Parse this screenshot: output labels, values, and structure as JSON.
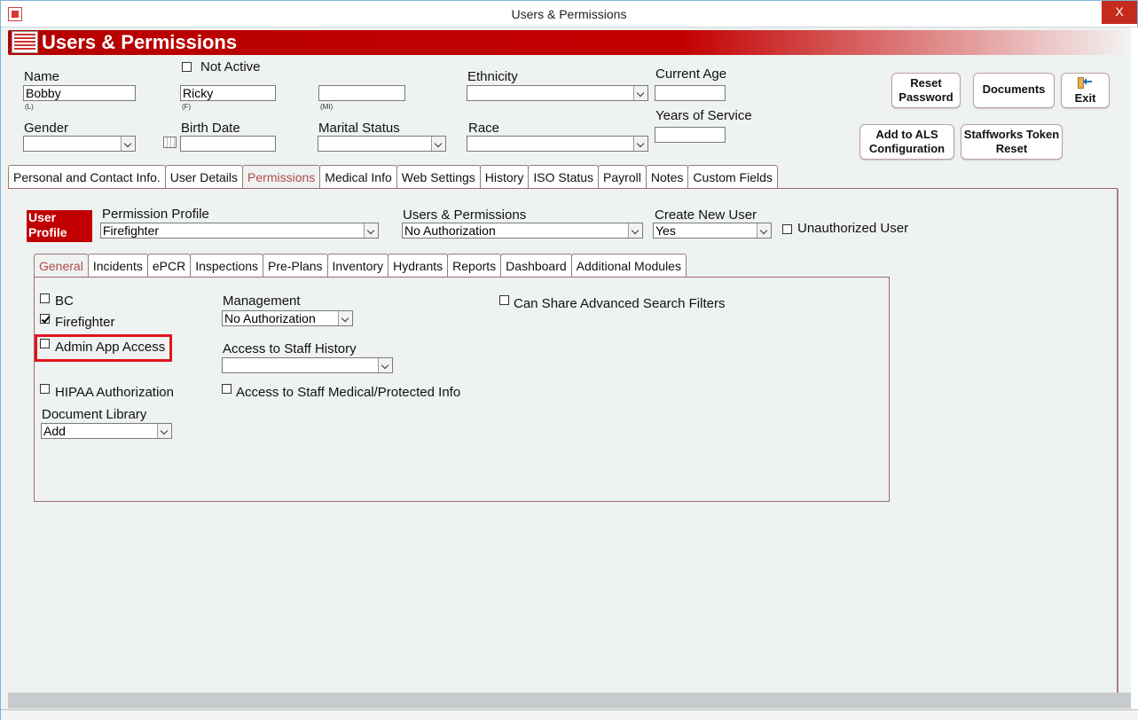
{
  "window": {
    "title": "Users & Permissions",
    "close_glyph": "X"
  },
  "banner": {
    "title": "Users & Permissions"
  },
  "form": {
    "name_label": "Name",
    "last_name": "Bobby",
    "last_hint": "(L)",
    "not_active_label": "Not Active",
    "first_name": "Ricky",
    "first_hint": "(F)",
    "middle_name": "",
    "middle_hint": "(MI)",
    "ethnicity_label": "Ethnicity",
    "ethnicity_value": "",
    "current_age_label": "Current Age",
    "current_age": "",
    "years_service_label": "Years of Service",
    "years_service": "",
    "gender_label": "Gender",
    "gender_value": "",
    "birth_date_label": "Birth Date",
    "birth_date": "",
    "marital_label": "Marital Status",
    "marital_value": "",
    "race_label": "Race",
    "race_value": ""
  },
  "buttons": {
    "reset_password": "Reset Password",
    "documents": "Documents",
    "exit": "Exit",
    "add_als": "Add to ALS Configuration",
    "staffworks": "Staffworks Token Reset"
  },
  "main_tabs": [
    "Personal and Contact Info.",
    "User Details",
    "Permissions",
    "Medical Info",
    "Web Settings",
    "History",
    "ISO Status",
    "Payroll",
    "Notes",
    "Custom Fields"
  ],
  "permissions": {
    "user_profile_badge": "User Profile",
    "permission_profile_label": "Permission Profile",
    "permission_profile_value": "Firefighter",
    "users_perms_label": "Users & Permissions",
    "users_perms_value": "No Authorization",
    "create_user_label": "Create New User",
    "create_user_value": "Yes",
    "unauthorized_label": "Unauthorized User"
  },
  "sub_tabs": [
    "General",
    "Incidents",
    "ePCR",
    "Inspections",
    "Pre-Plans",
    "Inventory",
    "Hydrants",
    "Reports",
    "Dashboard",
    "Additional Modules"
  ],
  "general": {
    "bc_label": "BC",
    "firefighter_label": "Firefighter",
    "admin_app_label": "Admin App Access",
    "hipaa_label": "HIPAA Authorization",
    "doc_library_label": "Document Library",
    "doc_library_value": "Add",
    "management_label": "Management",
    "management_value": "No Authorization",
    "staff_history_label": "Access to Staff History",
    "staff_history_value": "",
    "staff_medical_label": "Access to Staff Medical/Protected Info",
    "share_filters_label": "Can Share Advanced Search Filters"
  }
}
